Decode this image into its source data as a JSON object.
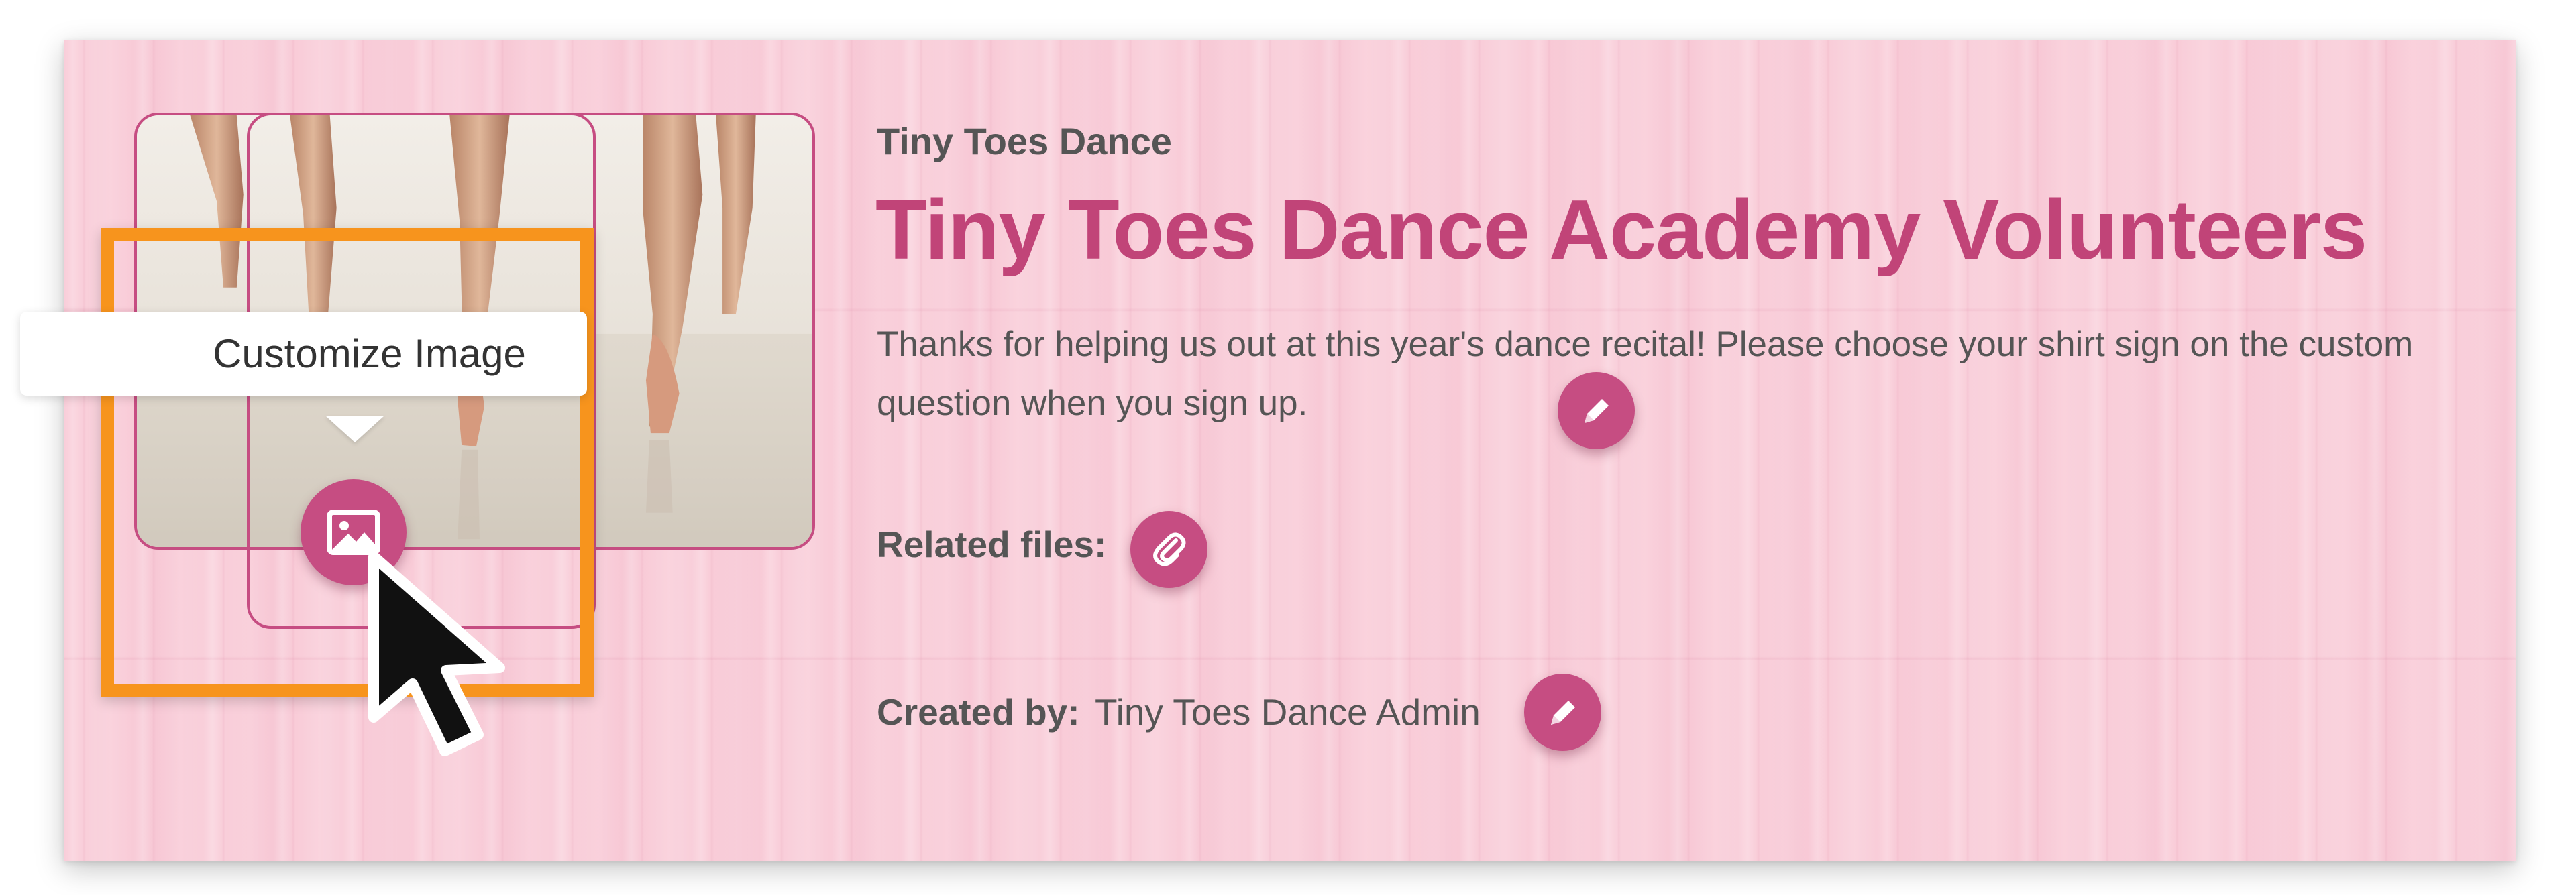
{
  "header": {
    "organization": "Tiny Toes Dance",
    "title": "Tiny Toes Dance Academy Volunteers",
    "description": "Thanks for helping us out at this year's dance recital! Please choose your shirt sign on the custom question when you sign up."
  },
  "related_files": {
    "label": "Related files:"
  },
  "created_by": {
    "label": "Created by:",
    "value": "Tiny Toes Dance Admin"
  },
  "image": {
    "tooltip": "Customize Image",
    "button_icon": "image-icon"
  },
  "icons": {
    "edit": "pencil-icon",
    "attach": "paperclip-icon",
    "cursor": "arrow-cursor-icon"
  },
  "colors": {
    "accent": "#c64d82",
    "title": "#c14478",
    "background": "#f9ccd8",
    "highlight": "#f7941d",
    "text": "#555555"
  }
}
